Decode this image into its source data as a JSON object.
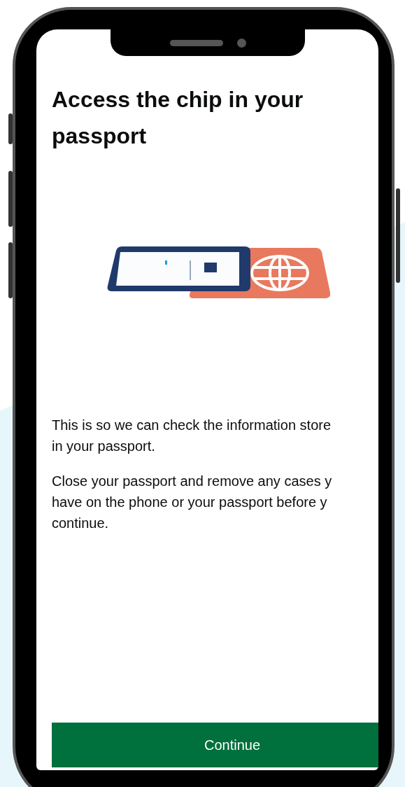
{
  "screen": {
    "heading": "Access the chip in your passport",
    "paragraphs": [
      {
        "lines": [
          "This is so we can check the information store",
          "in your passport."
        ]
      },
      {
        "lines": [
          "Close your passport and remove any cases y",
          "have on the phone or your passport before y",
          "continue."
        ]
      }
    ],
    "button": "Continue"
  }
}
